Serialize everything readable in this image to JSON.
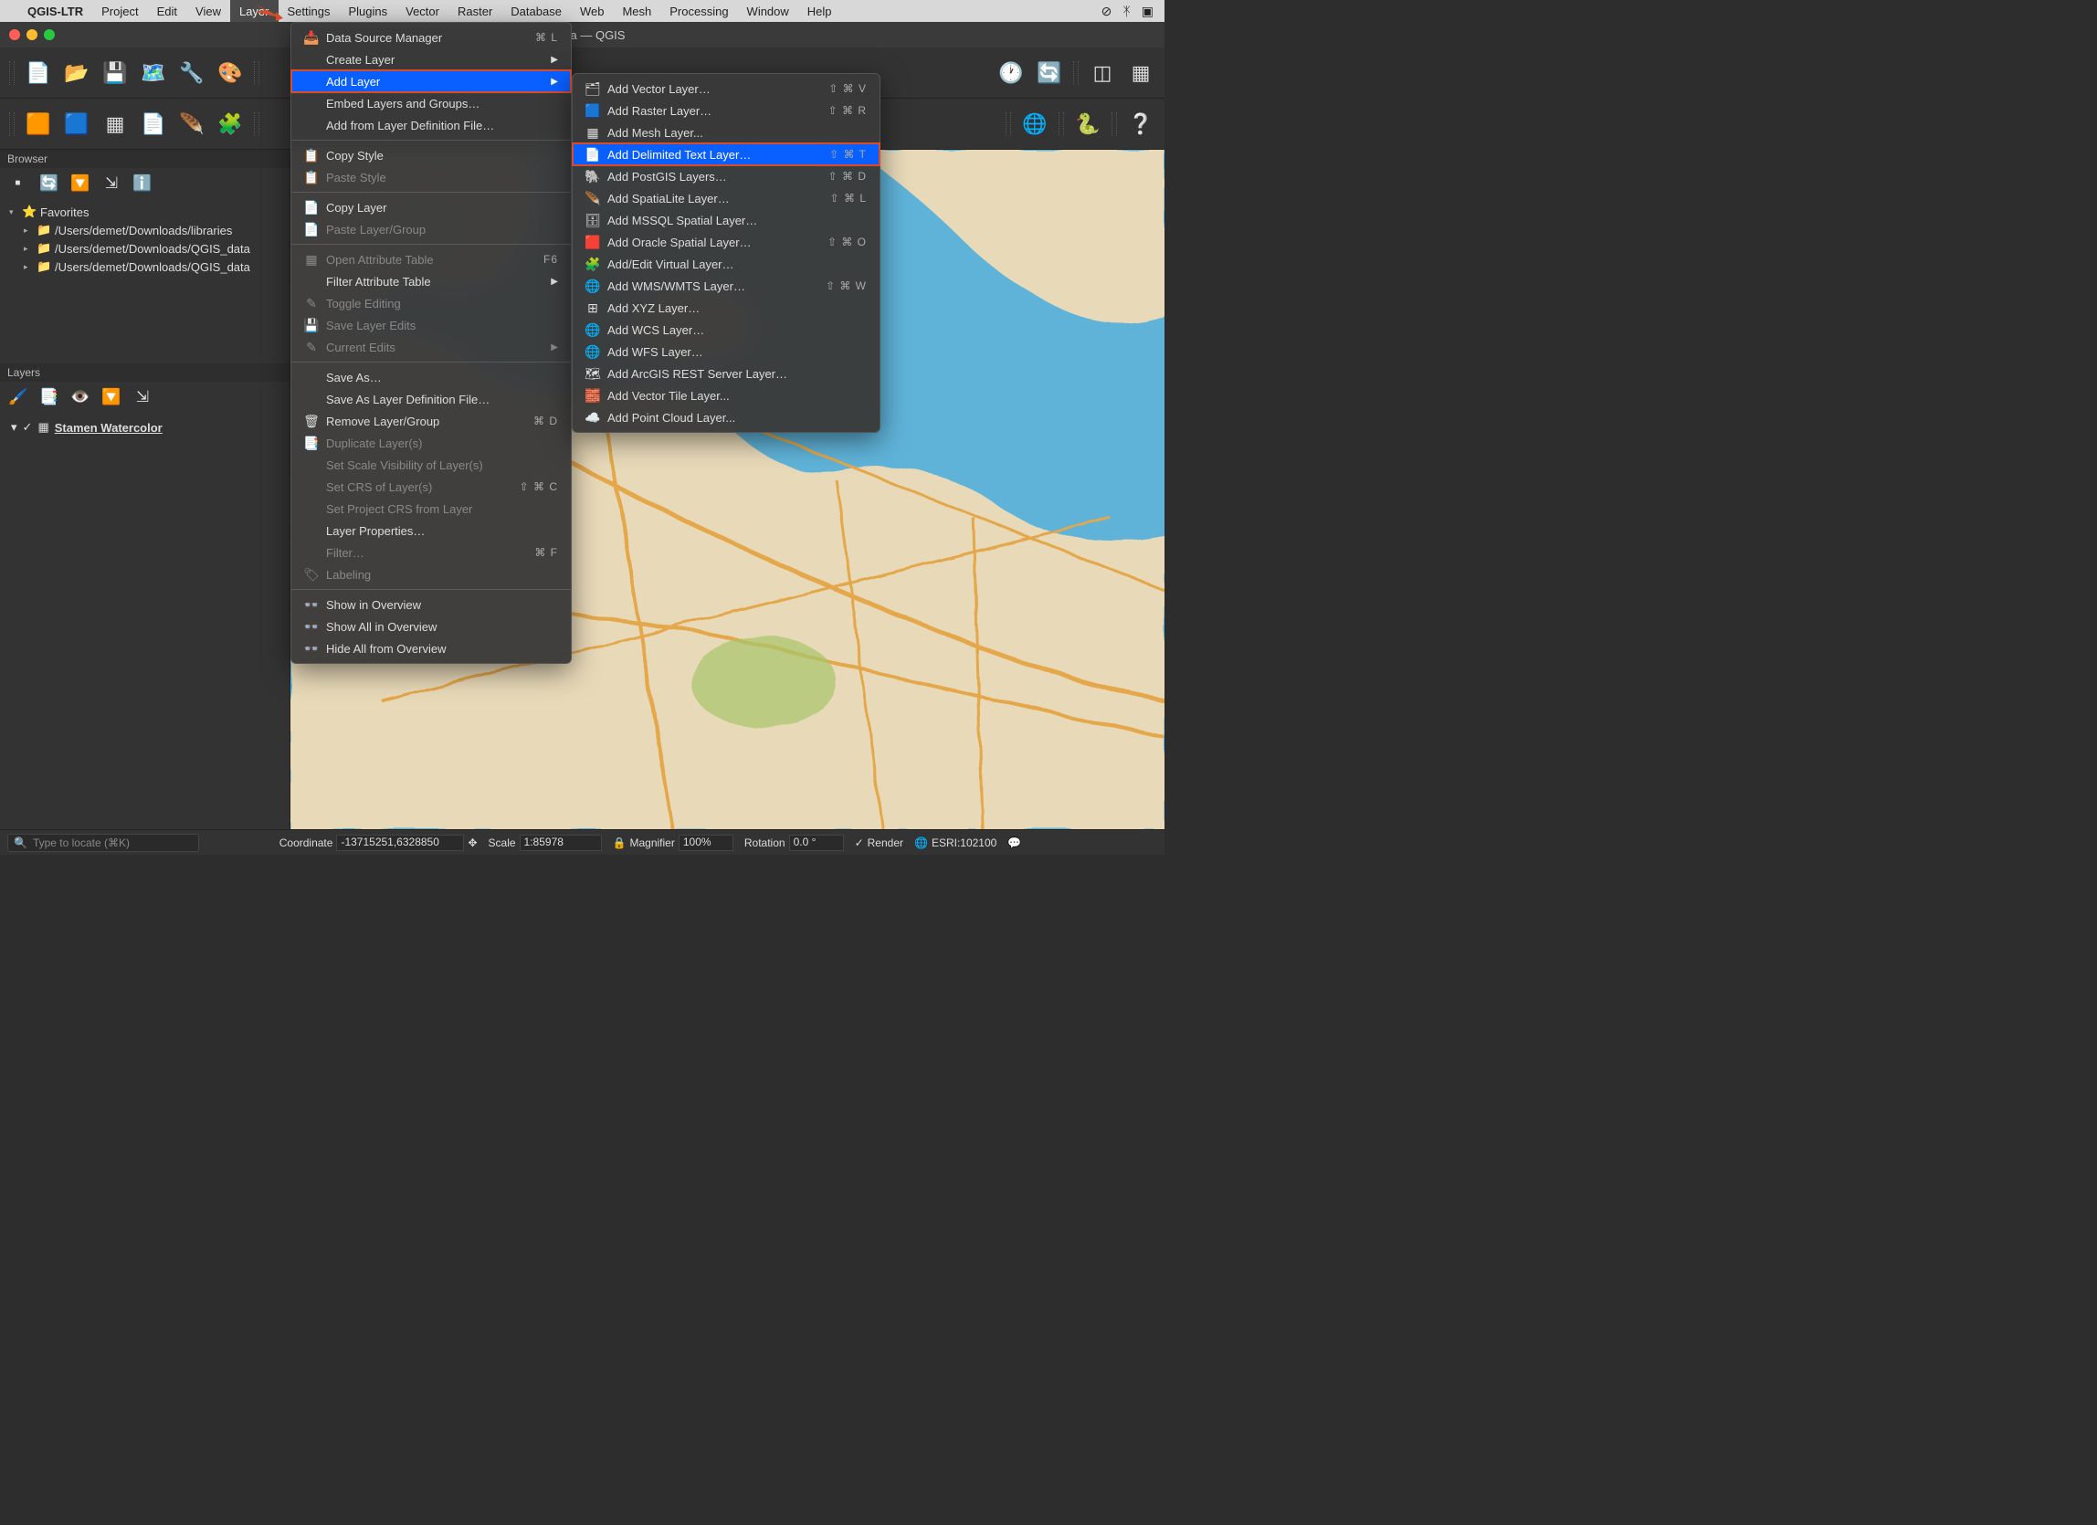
{
  "menubar": {
    "app": "QGIS-LTR",
    "items": [
      "Project",
      "Edit",
      "View",
      "Layer",
      "Settings",
      "Plugins",
      "Vector",
      "Raster",
      "Database",
      "Web",
      "Mesh",
      "Processing",
      "Window",
      "Help"
    ],
    "active_index": 3
  },
  "window": {
    "title": "*y-data — QGIS"
  },
  "layer_menu": [
    {
      "icon": "📥",
      "label": "Data Source Manager",
      "shortcut": "⌘ L"
    },
    {
      "label": "Create Layer",
      "submenu": true
    },
    {
      "label": "Add Layer",
      "submenu": true,
      "highlight": true,
      "hover": true
    },
    {
      "label": "Embed Layers and Groups…"
    },
    {
      "label": "Add from Layer Definition File…"
    },
    {
      "sep": true
    },
    {
      "icon": "📋",
      "label": "Copy Style"
    },
    {
      "icon": "📋",
      "label": "Paste Style",
      "disabled": true
    },
    {
      "sep": true
    },
    {
      "icon": "📄",
      "label": "Copy Layer"
    },
    {
      "icon": "📄",
      "label": "Paste Layer/Group",
      "disabled": true
    },
    {
      "sep": true
    },
    {
      "icon": "▦",
      "label": "Open Attribute Table",
      "shortcut": "F6",
      "disabled": true
    },
    {
      "label": "Filter Attribute Table",
      "submenu": true
    },
    {
      "icon": "✎",
      "label": "Toggle Editing",
      "disabled": true
    },
    {
      "icon": "💾",
      "label": "Save Layer Edits",
      "disabled": true
    },
    {
      "icon": "✎",
      "label": "Current Edits",
      "submenu": true,
      "disabled": true
    },
    {
      "sep": true
    },
    {
      "label": "Save As…"
    },
    {
      "label": "Save As Layer Definition File…"
    },
    {
      "icon": "🗑",
      "label": "Remove Layer/Group",
      "shortcut": "⌘ D"
    },
    {
      "icon": "📑",
      "label": "Duplicate Layer(s)",
      "disabled": true
    },
    {
      "label": "Set Scale Visibility of Layer(s)",
      "disabled": true
    },
    {
      "label": "Set CRS of Layer(s)",
      "shortcut": "⇧ ⌘ C",
      "disabled": true
    },
    {
      "label": "Set Project CRS from Layer",
      "disabled": true
    },
    {
      "label": "Layer Properties…"
    },
    {
      "label": "Filter…",
      "shortcut": "⌘ F",
      "disabled": true
    },
    {
      "icon": "🏷",
      "label": "Labeling",
      "disabled": true
    },
    {
      "sep": true
    },
    {
      "icon": "👓",
      "label": "Show in Overview"
    },
    {
      "icon": "👓",
      "label": "Show All in Overview"
    },
    {
      "icon": "👓",
      "label": "Hide All from Overview"
    }
  ],
  "addlayer_menu": [
    {
      "icon": "🗂",
      "label": "Add Vector Layer…",
      "shortcut": "⇧ ⌘ V"
    },
    {
      "icon": "🟦",
      "label": "Add Raster Layer…",
      "shortcut": "⇧ ⌘ R"
    },
    {
      "icon": "▦",
      "label": "Add Mesh Layer..."
    },
    {
      "icon": "📄",
      "label": "Add Delimited Text Layer…",
      "shortcut": "⇧ ⌘ T",
      "highlight": true,
      "hover": true
    },
    {
      "icon": "🐘",
      "label": "Add PostGIS Layers…",
      "shortcut": "⇧ ⌘ D"
    },
    {
      "icon": "🪶",
      "label": "Add SpatiaLite Layer…",
      "shortcut": "⇧ ⌘ L"
    },
    {
      "icon": "🗄",
      "label": "Add MSSQL Spatial Layer…"
    },
    {
      "icon": "🟥",
      "label": "Add Oracle Spatial Layer…",
      "shortcut": "⇧ ⌘ O"
    },
    {
      "icon": "🧩",
      "label": "Add/Edit Virtual Layer…"
    },
    {
      "icon": "🌐",
      "label": "Add WMS/WMTS Layer…",
      "shortcut": "⇧ ⌘ W"
    },
    {
      "icon": "⊞",
      "label": "Add XYZ Layer…"
    },
    {
      "icon": "🌐",
      "label": "Add WCS Layer…"
    },
    {
      "icon": "🌐",
      "label": "Add WFS Layer…"
    },
    {
      "icon": "🗺",
      "label": "Add ArcGIS REST Server Layer…"
    },
    {
      "icon": "🧱",
      "label": "Add Vector Tile Layer..."
    },
    {
      "icon": "☁️",
      "label": "Add Point Cloud Layer..."
    }
  ],
  "browser": {
    "title": "Browser",
    "favorites": "Favorites",
    "paths": [
      "/Users/demet/Downloads/libraries",
      "/Users/demet/Downloads/QGIS_data",
      "/Users/demet/Downloads/QGIS_data"
    ]
  },
  "layers": {
    "title": "Layers",
    "item": "Stamen Watercolor"
  },
  "statusbar": {
    "locator_placeholder": "Type to locate (⌘K)",
    "coord_label": "Coordinate",
    "coord_value": "-13715251,6328850",
    "scale_label": "Scale",
    "scale_value": "1:85978",
    "magnifier_label": "Magnifier",
    "magnifier_value": "100%",
    "rotation_label": "Rotation",
    "rotation_value": "0.0 °",
    "render_label": "Render",
    "crs": "ESRI:102100"
  }
}
